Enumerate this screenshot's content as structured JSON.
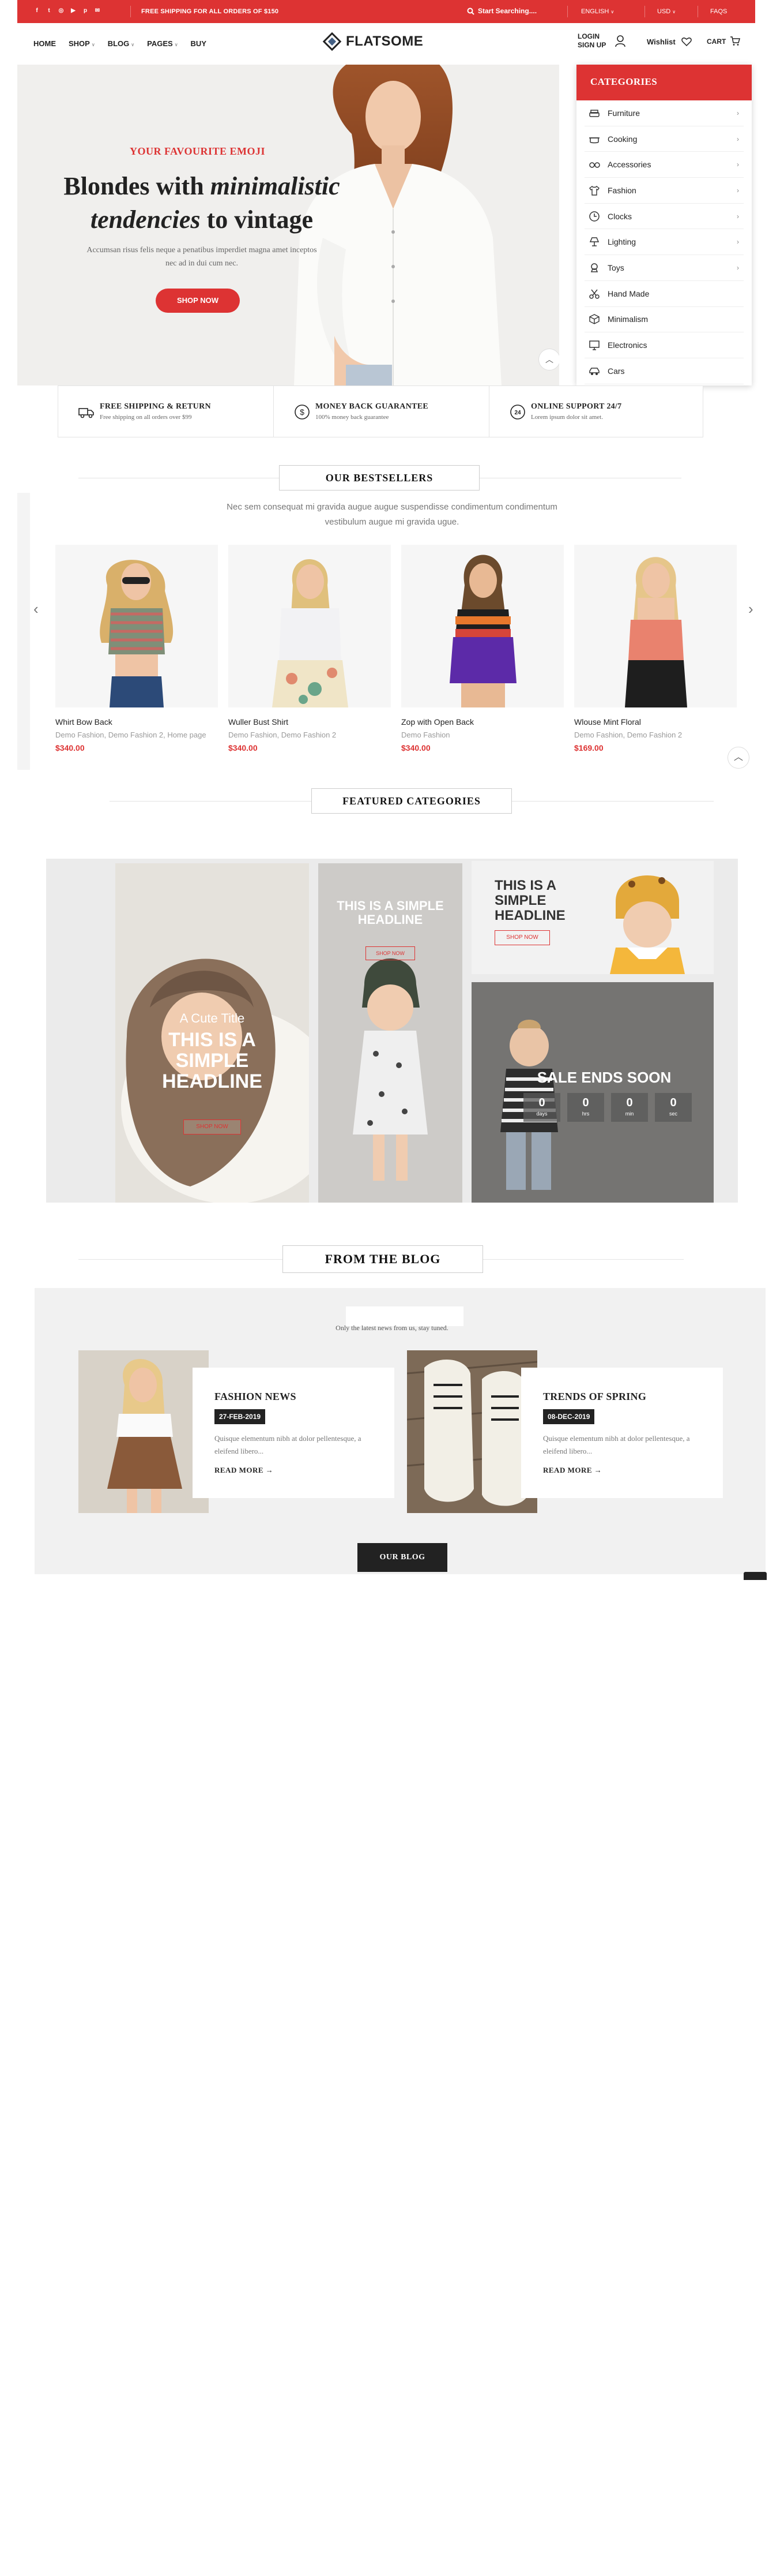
{
  "topbar": {
    "social_icons": [
      "facebook-icon",
      "twitter-icon",
      "instagram-icon",
      "youtube-icon",
      "pinterest-icon",
      "email-icon"
    ],
    "shipping_text": "FREE SHIPPING FOR ALL ORDERS OF $150",
    "search_label": "Start Searching....",
    "language": "ENGLISH",
    "currency": "USD",
    "faqs": "FAQS"
  },
  "header": {
    "nav": [
      "HOME",
      "SHOP",
      "BLOG",
      "PAGES",
      "BUY"
    ],
    "logo": "FLATSOME",
    "login_label": "LOGIN",
    "signup_label": "SIGN UP",
    "wishlist_label": "Wishlist",
    "cart_label": "CART"
  },
  "hero": {
    "kicker": "YOUR FAVOURITE EMOJI",
    "title_1": "Blondes with ",
    "title_italic_1": "minimalistic",
    "title_italic_2": "tendencies",
    "title_2": " to vintage",
    "subtitle": "Accumsan risus felis neque a penatibus imperdiet magna amet inceptos nec ad in dui cum nec.",
    "button": "SHOP NOW"
  },
  "categories": {
    "title": "CATEGORIES",
    "items": [
      {
        "label": "Furniture",
        "icon": "sofa-icon",
        "has_sub": true
      },
      {
        "label": "Cooking",
        "icon": "cooking-pot-icon",
        "has_sub": true
      },
      {
        "label": "Accessories",
        "icon": "glasses-icon",
        "has_sub": true
      },
      {
        "label": "Fashion",
        "icon": "tshirt-icon",
        "has_sub": true
      },
      {
        "label": "Clocks",
        "icon": "clock-icon",
        "has_sub": true
      },
      {
        "label": "Lighting",
        "icon": "lamp-icon",
        "has_sub": true
      },
      {
        "label": "Toys",
        "icon": "toy-icon",
        "has_sub": true
      },
      {
        "label": "Hand Made",
        "icon": "scissors-icon",
        "has_sub": false
      },
      {
        "label": "Minimalism",
        "icon": "cube-icon",
        "has_sub": false
      },
      {
        "label": "Electronics",
        "icon": "monitor-icon",
        "has_sub": false
      },
      {
        "label": "Cars",
        "icon": "car-icon",
        "has_sub": false
      }
    ]
  },
  "features": [
    {
      "title": "FREE SHIPPING & RETURN",
      "subtitle": "Free shipping on all orders over $99",
      "icon": "truck-icon"
    },
    {
      "title": "MONEY BACK GUARANTEE",
      "subtitle": "100% money back guarantee",
      "icon": "dollar-icon"
    },
    {
      "title": "ONLINE SUPPORT 24/7",
      "subtitle": "Lorem ipsum dolor sit amet.",
      "icon": "support-24-icon"
    }
  ],
  "bestsellers": {
    "title": "OUR BESTSELLERS",
    "subtitle": "Nec sem consequat mi gravida augue augue suspendisse condimentum condimentum vestibulum augue mi gravida ugue.",
    "products": [
      {
        "name": "Whirt Bow Back",
        "categories": "Demo Fashion, Demo Fashion 2, Home page",
        "price": "$340.00"
      },
      {
        "name": "Wuller Bust Shirt",
        "categories": "Demo Fashion, Demo Fashion 2",
        "price": "$340.00"
      },
      {
        "name": "Zop with Open Back",
        "categories": "Demo Fashion",
        "price": "$340.00"
      },
      {
        "name": "Wlouse Mint Floral",
        "categories": "Demo Fashion, Demo Fashion 2",
        "price": "$169.00"
      }
    ]
  },
  "featured": {
    "title": "FEATURED CATEGORIES",
    "card1_small": "A Cute Title",
    "card1_big": "THIS IS A SIMPLE HEADLINE",
    "card1_btn": "SHOP NOW",
    "card2_big": "THIS IS A SIMPLE HEADLINE",
    "card2_btn": "SHOP NOW",
    "card3_big": "THIS IS A SIMPLE HEADLINE",
    "card3_btn": "SHOP NOW",
    "sale_title": "SALE ENDS SOON",
    "countdown": [
      {
        "value": "0",
        "unit": "days"
      },
      {
        "value": "0",
        "unit": "hrs"
      },
      {
        "value": "0",
        "unit": "min"
      },
      {
        "value": "0",
        "unit": "sec"
      }
    ]
  },
  "blog": {
    "title": "FROM THE BLOG",
    "subtitle": "Only the latest news from us, stay tuned.",
    "posts": [
      {
        "title": "FASHION NEWS",
        "date": "27-FEB-2019",
        "excerpt": "Quisque elementum nibh at dolor pellentesque, a eleifend libero...",
        "more": "READ MORE"
      },
      {
        "title": "TRENDS OF SPRING",
        "date": "08-DEC-2019",
        "excerpt": "Quisque elementum nibh at dolor pellentesque, a eleifend libero...",
        "more": "READ MORE"
      }
    ],
    "button": "OUR BLOG"
  },
  "colors": {
    "accent": "#dd3333",
    "dark": "#222222"
  }
}
